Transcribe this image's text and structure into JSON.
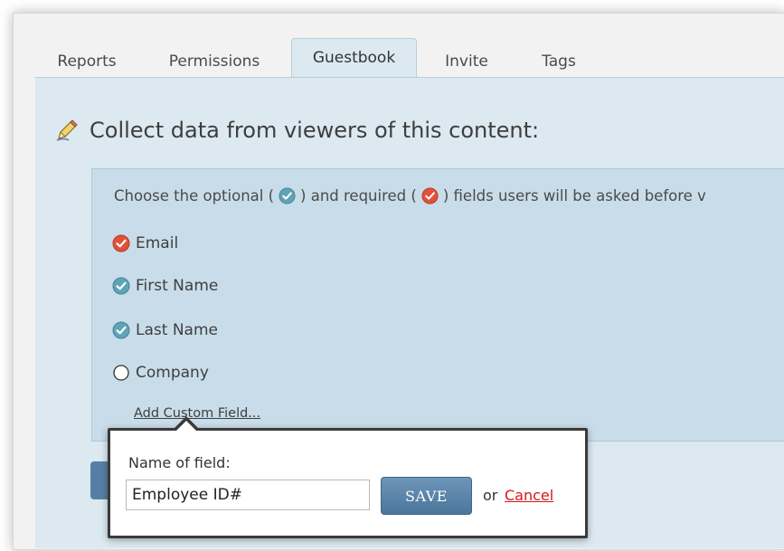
{
  "tabs": [
    {
      "label": "Reports",
      "active": false
    },
    {
      "label": "Permissions",
      "active": false
    },
    {
      "label": "Guestbook",
      "active": true
    },
    {
      "label": "Invite",
      "active": false
    },
    {
      "label": "Tags",
      "active": false
    }
  ],
  "heading": "Collect data from viewers of this content:",
  "intro": {
    "part1": "Choose the optional (",
    "part2": ") and required (",
    "part3": ") fields users will be asked before v"
  },
  "fields": [
    {
      "label": "Email",
      "state": "required"
    },
    {
      "label": "First Name",
      "state": "optional"
    },
    {
      "label": "Last Name",
      "state": "optional"
    },
    {
      "label": "Company",
      "state": "off"
    }
  ],
  "add_custom_field": "Add Custom Field...",
  "popup": {
    "label": "Name of field:",
    "input_value": "Employee ID#",
    "save_label": "SAVE",
    "or_text": "or",
    "cancel_label": "Cancel"
  },
  "colors": {
    "optional": "#5fa3b7",
    "required": "#e2503a",
    "panel": "#dce9f1",
    "button": "#5580a4",
    "cancel": "#d4161c"
  }
}
